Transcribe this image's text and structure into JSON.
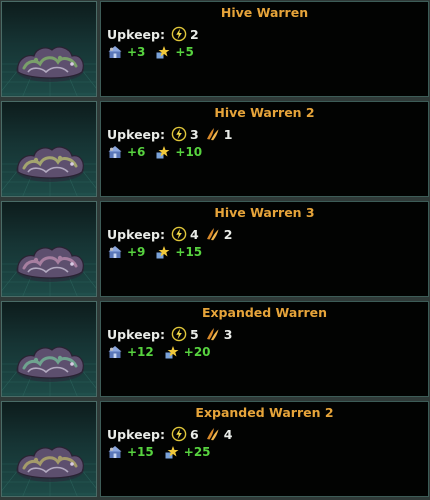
{
  "colors": {
    "title": "#e6a43a",
    "positive": "#57d33f",
    "text": "#e9ece8",
    "panel_bg": "#020302",
    "frame": "#3d5c57"
  },
  "labels": {
    "upkeep": "Upkeep:"
  },
  "buildings": [
    {
      "name": "Hive Warren",
      "energy": "2",
      "minerals": null,
      "housing": "+3",
      "amenities": "+5",
      "tint": "#7aa06a"
    },
    {
      "name": "Hive Warren 2",
      "energy": "3",
      "minerals": "1",
      "housing": "+6",
      "amenities": "+10",
      "tint": "#a3a56f"
    },
    {
      "name": "Hive Warren 3",
      "energy": "4",
      "minerals": "2",
      "housing": "+9",
      "amenities": "+15",
      "tint": "#a77fa0"
    },
    {
      "name": "Expanded Warren",
      "energy": "5",
      "minerals": "3",
      "housing": "+12",
      "amenities": "+20",
      "tint": "#6fa38f"
    },
    {
      "name": "Expanded Warren 2",
      "energy": "6",
      "minerals": "4",
      "housing": "+15",
      "amenities": "+25",
      "tint": "#a49b6a"
    }
  ],
  "icons": {
    "energy": "energy-bolt-icon",
    "minerals": "minerals-icon",
    "housing": "housing-icon",
    "amenities": "amenities-icon"
  }
}
